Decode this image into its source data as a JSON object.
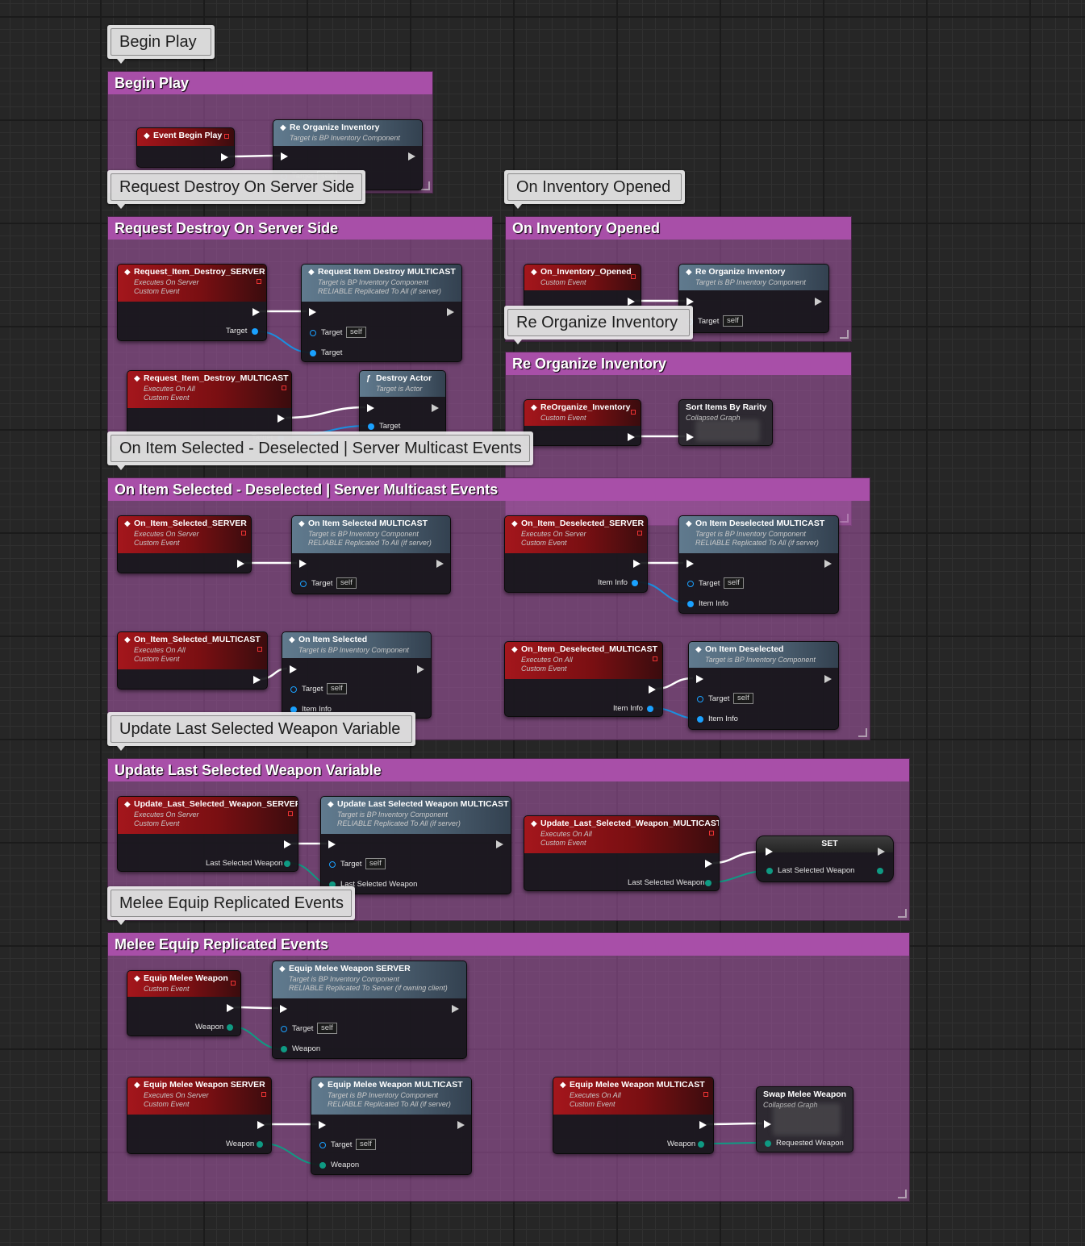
{
  "bubbles": {
    "b1": "Begin Play",
    "b2": "Request Destroy On Server Side",
    "b3": "On Inventory Opened",
    "b4": "Re Organize Inventory",
    "b5": "On Item Selected - Deselected | Server Multicast Events",
    "b6": "Update Last Selected Weapon Variable",
    "b7": "Melee Equip Replicated Events"
  },
  "comments": {
    "c1": "Begin Play",
    "c2": "Request Destroy On Server Side",
    "c3": "On Inventory Opened",
    "c4": "Re Organize Inventory",
    "c5": "On Item Selected - Deselected | Server Multicast Events",
    "c6": "Update Last Selected Weapon Variable",
    "c7": "Melee Equip Replicated Events"
  },
  "subtitles": {
    "custom_event": "Custom Event",
    "exec_server": "Executes On Server",
    "exec_all": "Executes On All",
    "target_inv": "Target is BP Inventory Component",
    "target_actor": "Target is Actor",
    "reliable_all": "RELIABLE Replicated To All (if server)",
    "reliable_server": "RELIABLE Replicated To Server (if owning client)",
    "collapsed": "Collapsed Graph"
  },
  "pins": {
    "target": "Target",
    "self": "self",
    "item_info": "Item Info",
    "last_selected_weapon": "Last Selected Weapon",
    "weapon": "Weapon",
    "requested_weapon": "Requested Weapon"
  },
  "nodes": {
    "event_begin_play": "Event Begin Play",
    "re_organize_inventory": "Re Organize Inventory",
    "req_destroy_server": "Request_Item_Destroy_SERVER",
    "req_destroy_multicast_call": "Request Item Destroy MULTICAST",
    "req_destroy_multicast_event": "Request_Item_Destroy_MULTICAST",
    "destroy_actor": "Destroy Actor",
    "on_inventory_opened": "On_Inventory_Opened",
    "reorganize_event": "ReOrganize_Inventory",
    "sort_items": "Sort Items By Rarity",
    "on_item_selected_server": "On_Item_Selected_SERVER",
    "on_item_selected_multicast_call": "On Item Selected MULTICAST",
    "on_item_deselected_server": "On_Item_Deselected_SERVER",
    "on_item_deselected_multicast_call": "On Item Deselected MULTICAST",
    "on_item_selected_multicast_event": "On_Item_Selected_MULTICAST",
    "on_item_selected": "On Item Selected",
    "on_item_deselected_multicast_event": "On_Item_Deselected_MULTICAST",
    "on_item_deselected": "On Item Deselected",
    "update_last_server": "Update_Last_Selected_Weapon_SERVER",
    "update_last_multicast_call": "Update Last Selected Weapon MULTICAST",
    "update_last_multicast_event": "Update_Last_Selected_Weapon_MULTICAST",
    "set": "SET",
    "equip_melee": "Equip Melee Weapon",
    "equip_melee_server_call": "Equip Melee Weapon SERVER",
    "equip_melee_server_event": "Equip Melee Weapon SERVER",
    "equip_melee_multicast_call": "Equip Melee Weapon MULTICAST",
    "equip_melee_multicast_event": "Equip Melee Weapon MULTICAST",
    "swap_melee": "Swap Melee Weapon"
  },
  "colors": {
    "event_header": "#a4161c",
    "function_header": "#607a8e",
    "comment_header": "#a84fa8",
    "exec_pin": "#ffffff",
    "object_pin": "#1aa1ff",
    "struct_pin": "#0f9a83"
  }
}
